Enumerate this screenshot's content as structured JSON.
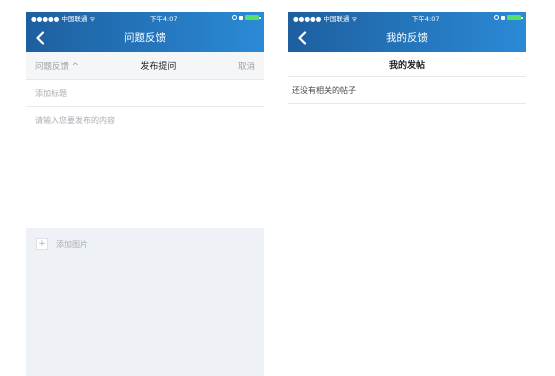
{
  "left_screen": {
    "status_bar": {
      "signal": "●●●●● 中国联通 ᯤ",
      "time": "下午4:07"
    },
    "nav": {
      "title": "问题反馈",
      "back_icon": "chevron-left-icon"
    },
    "tab_bar": {
      "dropdown_label": "问题反馈 ^",
      "center_label": "发布提问",
      "cancel_label": "取消"
    },
    "form": {
      "title_placeholder": "添加标题",
      "content_placeholder": "请输入您要发布的内容",
      "add_image_symbol": "+",
      "add_image_label": "添加图片"
    }
  },
  "right_screen": {
    "status_bar": {
      "signal": "●●●●● 中国联通 ᯤ",
      "time": "下午4:07"
    },
    "nav": {
      "title": "我的反馈",
      "back_icon": "chevron-left-icon"
    },
    "section_title": "我的发帖",
    "empty_text": "还没有相关的帖子"
  },
  "colors": {
    "nav_gradient_start": "#1d5f9f",
    "nav_gradient_end": "#2b8ad6",
    "battery": "#55e06a",
    "image_area_bg": "#eef1f6"
  }
}
